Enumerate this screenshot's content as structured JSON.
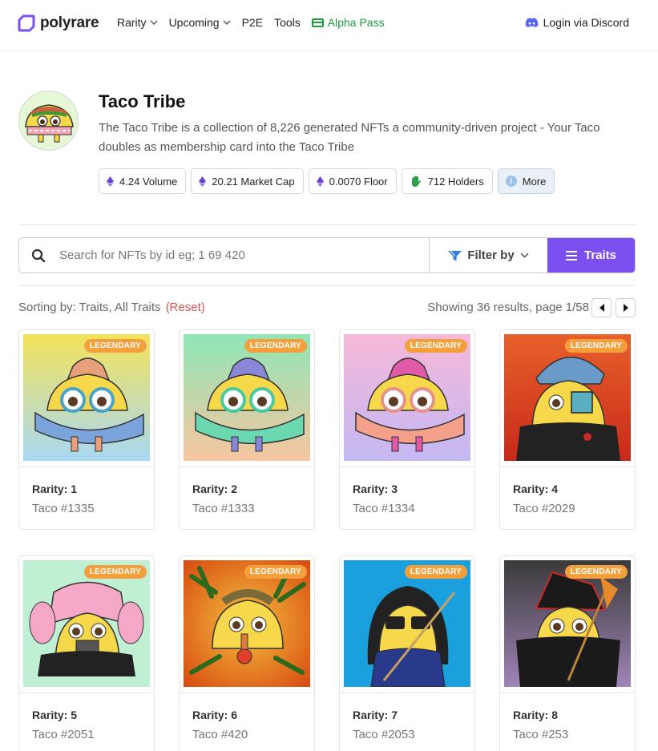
{
  "brand": {
    "name": "polyrare",
    "color": "#7b4ff0"
  },
  "nav": {
    "items": [
      {
        "label": "Rarity",
        "has_dropdown": true
      },
      {
        "label": "Upcoming",
        "has_dropdown": true
      },
      {
        "label": "P2E",
        "has_dropdown": false
      },
      {
        "label": "Tools",
        "has_dropdown": false
      }
    ],
    "alpha_pass": "Alpha Pass",
    "login": "Login via Discord"
  },
  "collection": {
    "title": "Taco Tribe",
    "description": "The Taco Tribe is a collection of 8,226 generated NFTs a community-driven project - Your Taco doubles as membership card into the Taco Tribe",
    "stats": {
      "volume": "4.24 Volume",
      "market_cap": "20.21 Market Cap",
      "floor": "0.0070 Floor",
      "holders": "712 Holders",
      "more": "More"
    }
  },
  "search": {
    "placeholder": "Search for NFTs by id eg; 1 69 420",
    "filter_label": "Filter by",
    "traits_label": "Traits"
  },
  "sorting": {
    "label": "Sorting by: Traits, All Traits",
    "reset": "(Reset)",
    "results": "Showing 36 results, page 1/58"
  },
  "cards": [
    {
      "rarity": "Rarity: 1",
      "name": "Taco #1335",
      "badge": "LEGENDARY"
    },
    {
      "rarity": "Rarity: 2",
      "name": "Taco #1333",
      "badge": "LEGENDARY"
    },
    {
      "rarity": "Rarity: 3",
      "name": "Taco #1334",
      "badge": "LEGENDARY"
    },
    {
      "rarity": "Rarity: 4",
      "name": "Taco #2029",
      "badge": "LEGENDARY"
    },
    {
      "rarity": "Rarity: 5",
      "name": "Taco #2051",
      "badge": "LEGENDARY"
    },
    {
      "rarity": "Rarity: 6",
      "name": "Taco #420",
      "badge": "LEGENDARY"
    },
    {
      "rarity": "Rarity: 7",
      "name": "Taco #2053",
      "badge": "LEGENDARY"
    },
    {
      "rarity": "Rarity: 8",
      "name": "Taco #253",
      "badge": "LEGENDARY"
    }
  ],
  "colors": {
    "accent": "#7b4ff0",
    "badge": "#f3a03c",
    "alpha": "#1d9b3a",
    "reset": "#d9534f"
  }
}
